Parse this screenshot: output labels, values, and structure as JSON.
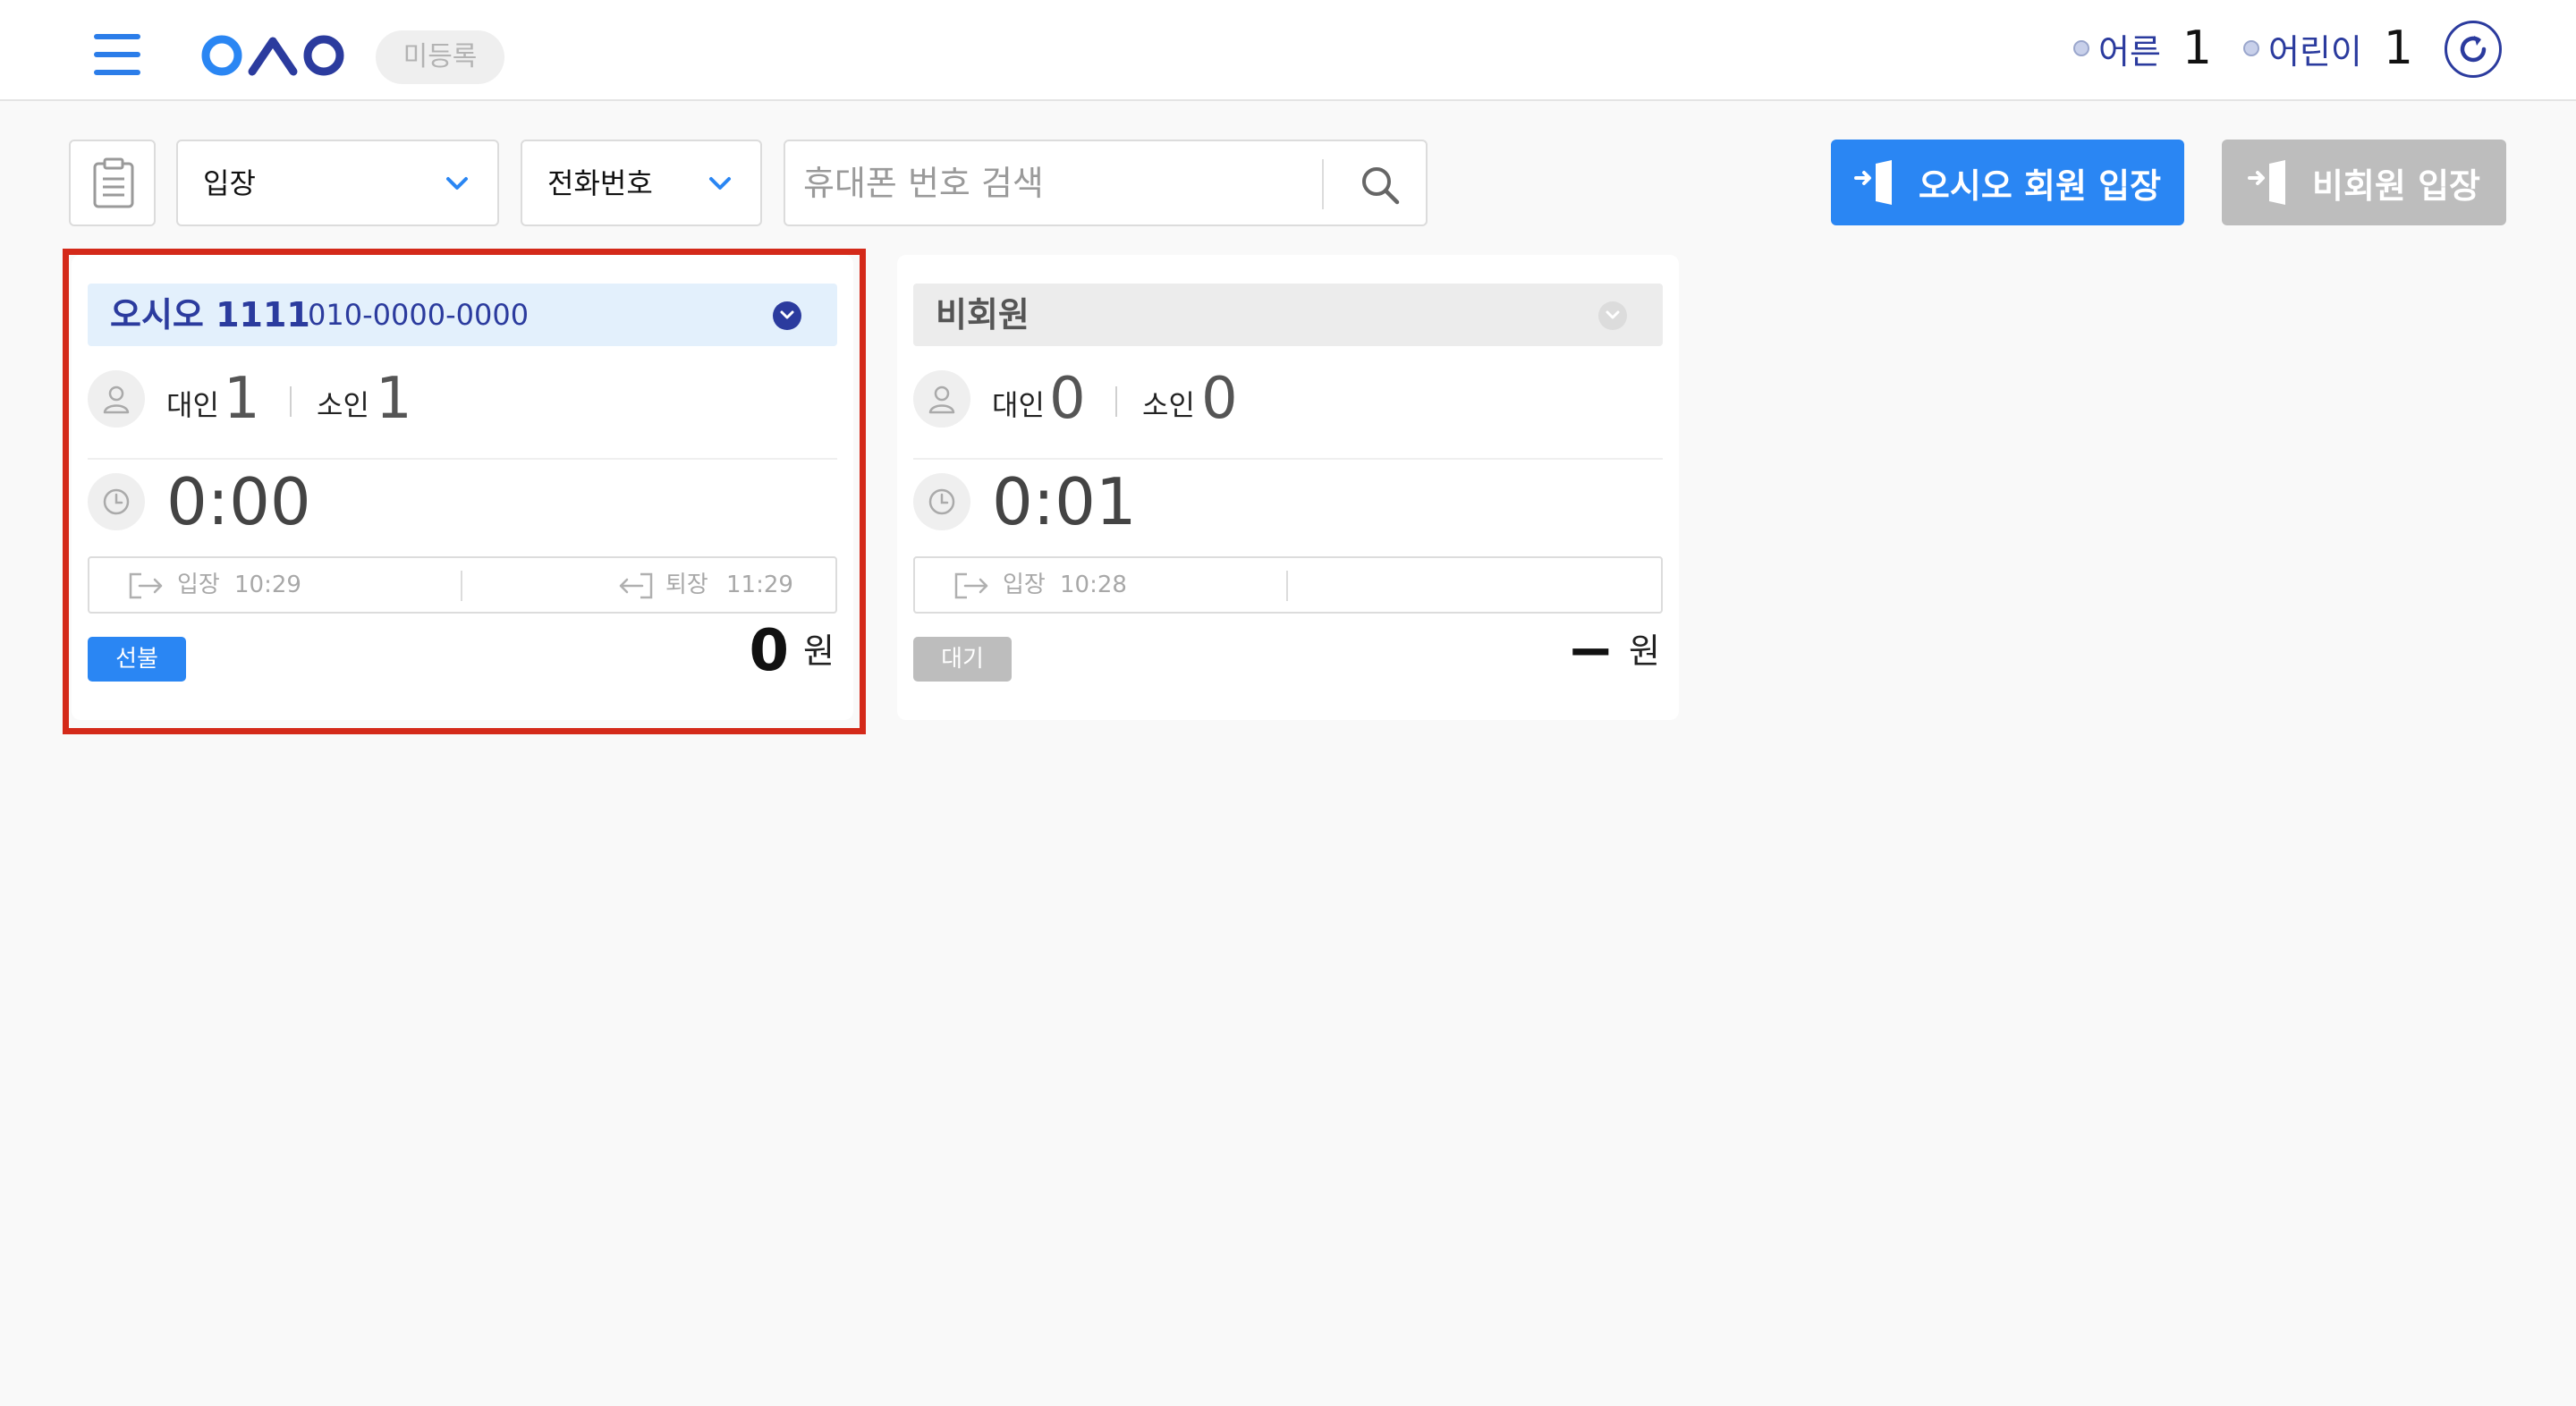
{
  "header": {
    "status_label": "미등록",
    "counts": [
      {
        "label": "어른",
        "value": "1"
      },
      {
        "label": "어린이",
        "value": "1"
      }
    ]
  },
  "toolbar": {
    "entry_select": "입장",
    "type_select": "전화번호",
    "search_placeholder": "휴대폰 번호 검색",
    "member_button": "오시오 회원 입장",
    "nonmember_button": "비회원 입장"
  },
  "cards": [
    {
      "name": "오시오 1111",
      "phone": "010-0000-0000",
      "adult_label": "대인",
      "adult_count": "1",
      "child_label": "소인",
      "child_count": "1",
      "elapsed": "0:00",
      "entry_label": "입장",
      "entry_time": "10:29",
      "exit_label": "퇴장",
      "exit_time": "11:29",
      "badge": "선불",
      "price": "0",
      "currency": "원",
      "selected": true
    },
    {
      "name": "비회원",
      "phone": "",
      "adult_label": "대인",
      "adult_count": "0",
      "child_label": "소인",
      "child_count": "0",
      "elapsed": "0:01",
      "entry_label": "입장",
      "entry_time": "10:28",
      "exit_label": "",
      "exit_time": "",
      "badge": "대기",
      "price": "−",
      "currency": "원",
      "selected": false
    }
  ],
  "colors": {
    "accent": "#2a86f3",
    "brand_navy": "#2b3b9e",
    "highlight": "#d42a1a",
    "disabled": "#bdbdbd"
  },
  "icons": [
    "menu-icon",
    "logo",
    "refresh-icon",
    "calendar-icon",
    "chevron-down-icon",
    "search-icon",
    "door-enter-icon",
    "person-icon",
    "clock-icon",
    "entry-icon",
    "exit-icon"
  ]
}
